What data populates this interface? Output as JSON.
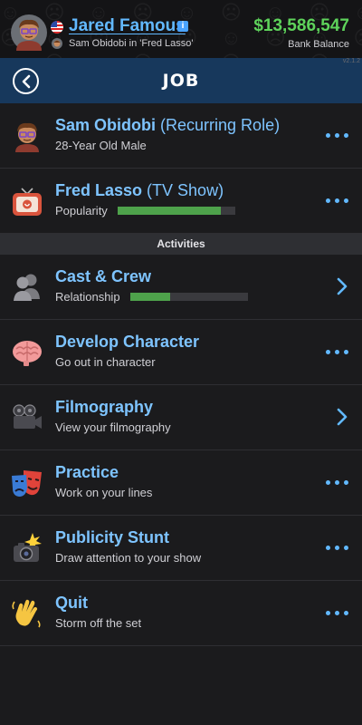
{
  "header": {
    "player_name": "Jared Famous",
    "subtitle": "Sam Obidobi in 'Fred Lasso'",
    "balance": "$13,586,547",
    "balance_label": "Bank Balance",
    "version": "v2.1.2",
    "info_badge": "i"
  },
  "nav": {
    "title": "JOB"
  },
  "role": {
    "title": "Sam Obidobi",
    "title_suffix": "(Recurring Role)",
    "subtitle": "28-Year Old Male"
  },
  "show": {
    "title": "Fred Lasso",
    "title_suffix": "(TV Show)",
    "subtitle": "Popularity",
    "popularity": 0.88
  },
  "section": {
    "title": "Activities"
  },
  "activities": [
    {
      "title": "Cast & Crew",
      "subtitle": "Relationship",
      "relationship": 0.34,
      "action": "chevron"
    },
    {
      "title": "Develop Character",
      "subtitle": "Go out in character",
      "action": "dots"
    },
    {
      "title": "Filmography",
      "subtitle": "View your filmography",
      "action": "chevron"
    },
    {
      "title": "Practice",
      "subtitle": "Work on your lines",
      "action": "dots"
    },
    {
      "title": "Publicity Stunt",
      "subtitle": "Draw attention to your show",
      "action": "dots"
    },
    {
      "title": "Quit",
      "subtitle": "Storm off the set",
      "action": "dots"
    }
  ],
  "colors": {
    "accent": "#7ec4ff",
    "nav": "#17385c",
    "money": "#5ed35b",
    "bar_fill": "#4ea24b"
  },
  "icons": [
    "avatar-icon",
    "flag-icon",
    "tv-icon",
    "people-icon",
    "brain-icon",
    "camera-icon",
    "theater-masks-icon",
    "flash-camera-icon",
    "waving-hand-icon"
  ]
}
